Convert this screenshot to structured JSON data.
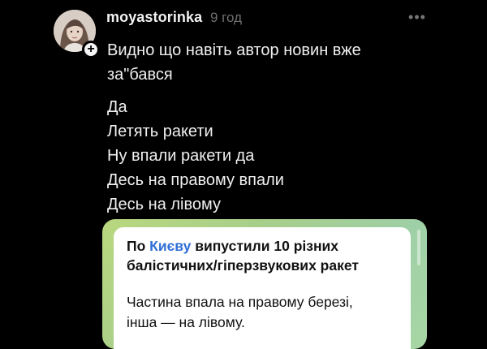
{
  "post": {
    "username": "moyastorinka",
    "timestamp": "9 год",
    "more_icon": "more-horizontal-icon",
    "follow_icon": "plus-icon",
    "text_lines": [
      "Видно що навіть автор новин вже",
      "за\"бався",
      "Да",
      "Летять ракети",
      "Ну впали ракети да",
      "Десь на правому впали",
      "Десь на лівому"
    ]
  },
  "quoted_message": {
    "head_prefix": "По",
    "head_link": "Києву",
    "head_rest_1": "випустили 10 різних",
    "head_rest_2": "балістичних/гіперзвукових ракет",
    "sub_1": "Частина впала на правому березі,",
    "sub_2": "інша — на лівому.",
    "frame_colors": [
      "#b9d77e",
      "#9fcfa6"
    ],
    "link_color": "#2f6fd6"
  }
}
